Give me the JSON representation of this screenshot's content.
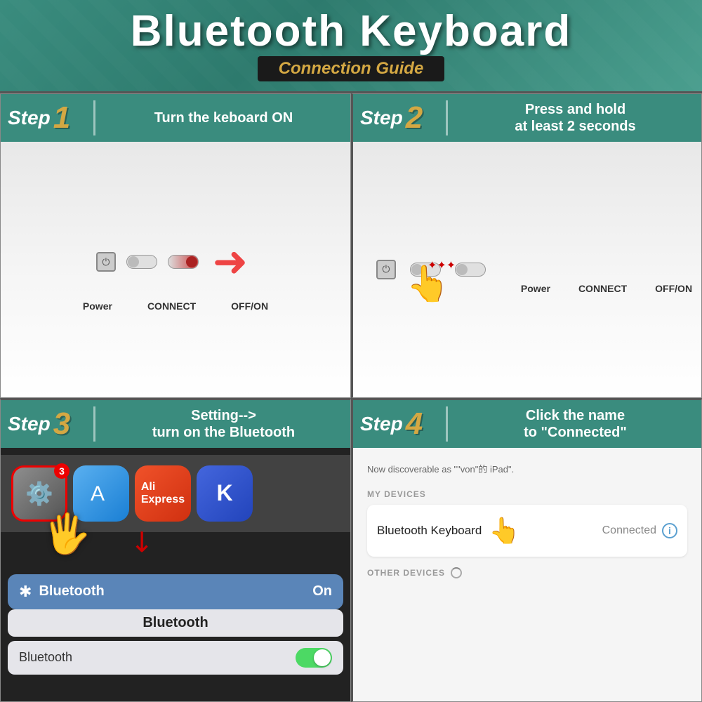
{
  "header": {
    "title": "Bluetooth Keyboard",
    "subtitle": "Connection Guide"
  },
  "steps": [
    {
      "id": 1,
      "number": "1",
      "word": "Step",
      "description": "Turn the keboard ON",
      "switches": {
        "power_label": "Power",
        "connect_label": "CONNECT",
        "offon_label": "OFF/ON"
      }
    },
    {
      "id": 2,
      "number": "2",
      "word": "Step",
      "description": "Press and hold\nat least 2 seconds",
      "switches": {
        "power_label": "Power",
        "connect_label": "CONNECT",
        "offon_label": "OFF/ON"
      }
    },
    {
      "id": 3,
      "number": "3",
      "word": "Step",
      "description": "Setting-->\nturn on the Bluetooth",
      "bluetooth_panel": {
        "icon": "⊕",
        "label": "Bluetooth",
        "status": "On"
      },
      "settings_panel": {
        "label": "Bluetooth"
      },
      "badge_count": "3"
    },
    {
      "id": 4,
      "number": "4",
      "word": "Step",
      "description": "Click the name\nto \"Connected\"",
      "discoverable_text": "Now discoverable as \"\"von\"的 iPad\".",
      "my_devices_label": "MY DEVICES",
      "device_name": "Bluetooth  Keyboard",
      "connected_text": "Connected",
      "other_devices_label": "OTHER DEVICES"
    }
  ]
}
